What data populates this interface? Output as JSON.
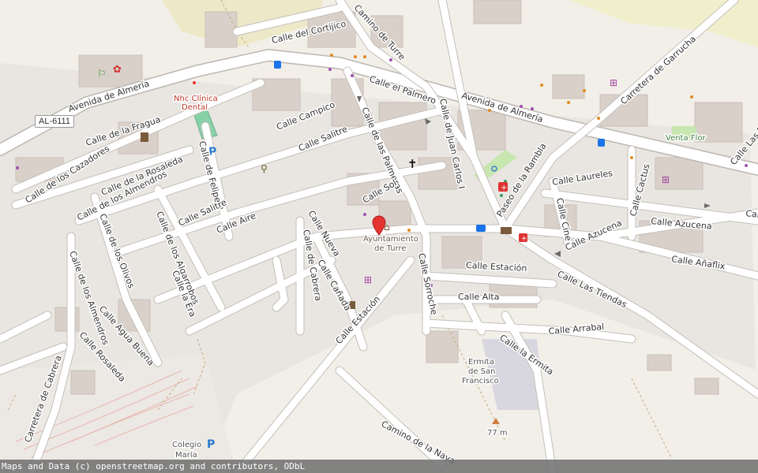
{
  "map": {
    "road_ref": "AL-6111",
    "streets": {
      "avenida_almeria_w": "Avenida de Almería",
      "avenida_almeria_e": "Avenida de Almería",
      "calle_cortijico": "Calle del Cortijico",
      "camino_turre": "Camino de Turre",
      "calle_palmero": "Calle el Palmero",
      "calle_juan_carlos": "Calle de Juan Carlos I",
      "carretera_garrucha": "Carretera de Garrucha",
      "calle_fragua": "Calle de la Fragua",
      "calle_campico": "Calle Campico",
      "calle_salitre_n": "Calle Salitre",
      "calle_palmeras": "Calle de las Palmeras",
      "calle_cazadores": "Calle de los Cazadores",
      "calle_rosaleda": "Calle de la Rosaleda",
      "calle_almendros_n": "Calle de los Almendros",
      "calle_felipe": "Calle de Felipe II",
      "calle_salitre_s": "Calle Salitre",
      "calle_sol": "Calle Sol",
      "paseo_rambla": "Paseo de la Rambla",
      "calle_laureles": "Calle Laureles",
      "calle_cactus": "Calle Cactus",
      "calle_las_e": "Calle Las F",
      "calle_e_edge": "Calle",
      "calle_cine": "Calle Cine",
      "calle_azucena_a": "Calle Azucena",
      "calle_azucena_b": "Calle Azucena",
      "calle_anaflix": "Calle Añaflix",
      "calle_olivos": "Calle de los Olivos",
      "calle_algarrobos": "Calle de los Algarrobos",
      "calle_aire": "Calle Aire",
      "calle_nueva": "Calle Nueva",
      "calle_cabrera": "Calle de Cabrera",
      "calle_canada": "Calle Cañada",
      "calle_sorroche": "Calle Sorroche",
      "calle_estacion_e": "Calle Estación",
      "calle_alta": "Calle Alta",
      "calle_tiendas": "Calle Las Tiendas",
      "calle_arrabal": "Calle Arrabal",
      "calle_ermita": "Calle la Ermita",
      "calle_estacion_w": "Calle Estación",
      "calle_almendros_s": "Calle de los Almendros",
      "calle_la_era": "Calle la Era",
      "calle_agua_buena": "Calle Agua Buena",
      "calle_rosaleda_s": "Calle Rosaleda",
      "carretera_cabrera": "Carretera de Cabrera",
      "camino_nava": "Camino de la Nava"
    },
    "pois": {
      "clinic": "Nhc Clínica\nDental",
      "town_hall_line1": "Ayuntamiento",
      "town_hall_line2": "de Turre",
      "ermita_line1": "Ermita",
      "ermita_line2": "de San",
      "ermita_line3": "Francisco",
      "venta_flor": "Venta Flor",
      "school_line1": "Colegio",
      "school_line2": "María",
      "peak_elevation": "77 m"
    },
    "icons": [
      "runner-icon",
      "paw-icon",
      "parking-icon",
      "shop-icon",
      "cross-icon",
      "town-hall-icon",
      "bus-icon",
      "pharmacy-icon",
      "taxi-icon",
      "atm-icon",
      "post-icon",
      "cart-icon",
      "peak-icon",
      "map-marker-icon"
    ],
    "colors": {
      "background": "#f2efe9",
      "road": "#ffffff",
      "block": "#dcd6cf",
      "block_residential": "#e0dfdf",
      "park": "#c8e6b0",
      "pitch": "#88d0a8",
      "farmland": "#f0efcc",
      "marker": "#e3342f"
    },
    "attribution": "Maps and Data (c) openstreetmap.org and contributors, ODbL"
  }
}
